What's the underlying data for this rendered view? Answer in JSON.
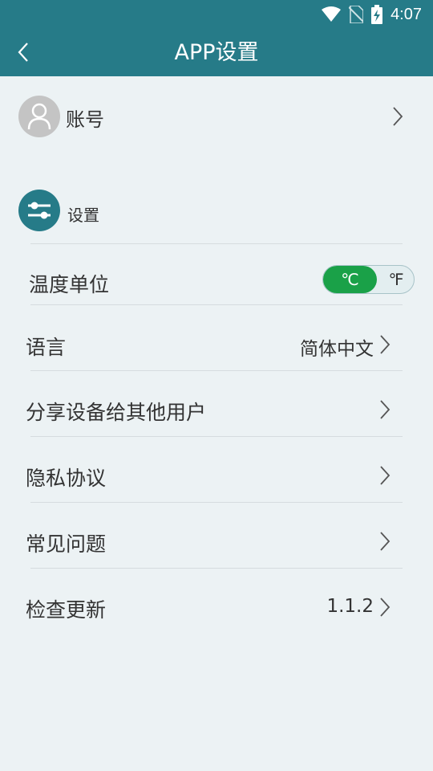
{
  "status_bar": {
    "time": "4:07",
    "icons": [
      "wifi-icon",
      "no-sim-icon",
      "battery-charging-icon"
    ]
  },
  "app_bar": {
    "title": "APP设置",
    "back_icon": "back-arrow-icon"
  },
  "account": {
    "label": "账号",
    "avatar_icon": "user-icon"
  },
  "settings_section": {
    "label": "设置",
    "icon": "sliders-icon"
  },
  "temperature_unit": {
    "label": "温度单位",
    "options": [
      "℃",
      "℉"
    ],
    "selected": "℃"
  },
  "rows": [
    {
      "label": "语言",
      "value": "简体中文"
    },
    {
      "label": "分享设备给其他用户",
      "value": ""
    },
    {
      "label": "隐私协议",
      "value": ""
    },
    {
      "label": "常见问题",
      "value": ""
    },
    {
      "label": "检查更新",
      "value": "1.1.2"
    }
  ],
  "colors": {
    "primary": "#267b88",
    "background": "#ecf2f4",
    "toggle_active": "#1aa148",
    "avatar_bg": "#c4c4c4"
  }
}
